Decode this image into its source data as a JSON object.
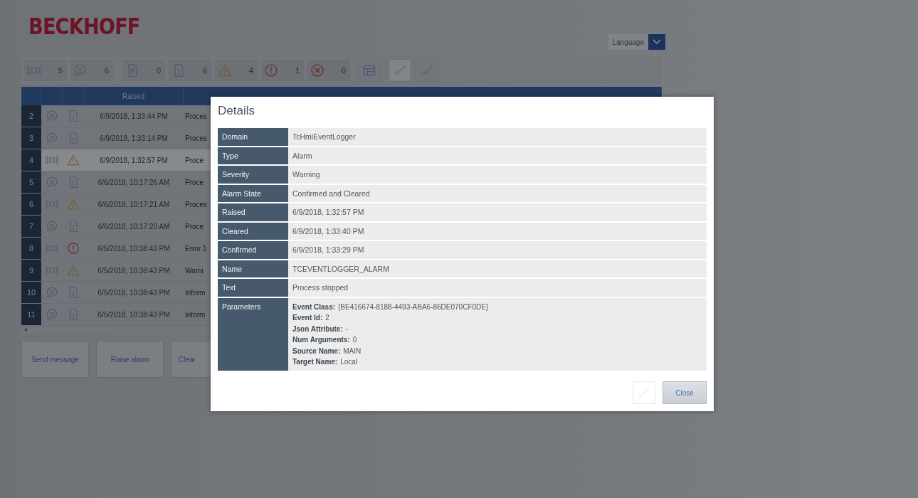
{
  "logo": "BECKHOFF",
  "language": {
    "label": "Language"
  },
  "filters": [
    {
      "kind": "alarm",
      "count": "5"
    },
    {
      "kind": "message",
      "count": "6"
    },
    {
      "kind": "document",
      "count": "0"
    },
    {
      "kind": "info",
      "count": "6"
    },
    {
      "kind": "warning",
      "count": "4"
    },
    {
      "kind": "error",
      "count": "1"
    },
    {
      "kind": "critical",
      "count": "0"
    }
  ],
  "table": {
    "columns": [
      "",
      "",
      "",
      "Raised"
    ],
    "rows": [
      {
        "number": "2",
        "icons": [
          {
            "kind": "message"
          },
          {
            "kind": "info"
          }
        ],
        "raised": "6/9/2018, 1:33:44 PM",
        "text": "Proces",
        "selected": false
      },
      {
        "number": "3",
        "icons": [
          {
            "kind": "message"
          },
          {
            "kind": "info"
          }
        ],
        "raised": "6/9/2018, 1:33:14 PM",
        "text": "Proces",
        "selected": false
      },
      {
        "number": "4",
        "icons": [
          {
            "kind": "alarm"
          },
          {
            "kind": "warning"
          }
        ],
        "raised": "6/9/2018, 1:32:57 PM",
        "text": "Proce",
        "selected": true
      },
      {
        "number": "5",
        "icons": [
          {
            "kind": "message"
          },
          {
            "kind": "info"
          }
        ],
        "raised": "6/6/2018, 10:17:26 AM",
        "text": "Proce",
        "selected": false
      },
      {
        "number": "6",
        "icons": [
          {
            "kind": "alarm"
          },
          {
            "kind": "warning"
          }
        ],
        "raised": "6/6/2018, 10:17:21 AM",
        "text": "Proces",
        "selected": false
      },
      {
        "number": "7",
        "icons": [
          {
            "kind": "message"
          },
          {
            "kind": "info"
          }
        ],
        "raised": "6/6/2018, 10:17:20 AM",
        "text": "Proce",
        "selected": false
      },
      {
        "number": "8",
        "icons": [
          {
            "kind": "alarm"
          },
          {
            "kind": "error"
          }
        ],
        "raised": "6/5/2018, 10:38:43 PM",
        "text": "Error 1",
        "selected": false
      },
      {
        "number": "9",
        "icons": [
          {
            "kind": "alarm"
          },
          {
            "kind": "warning"
          }
        ],
        "raised": "6/5/2018, 10:38:43 PM",
        "text": "Warni",
        "selected": false
      },
      {
        "number": "10",
        "icons": [
          {
            "kind": "message"
          },
          {
            "kind": "info"
          }
        ],
        "raised": "6/5/2018, 10:38:43 PM",
        "text": "Inform",
        "selected": false
      },
      {
        "number": "11",
        "icons": [
          {
            "kind": "message"
          },
          {
            "kind": "info"
          }
        ],
        "raised": "6/5/2018, 10:38:43 PM",
        "text": "Inform",
        "selected": false
      }
    ]
  },
  "buttons": [
    "Send message",
    "Raise alarm",
    "Clear"
  ],
  "dialog": {
    "title": "Details",
    "fields": [
      {
        "label": "Domain",
        "value": "TcHmiEventLogger"
      },
      {
        "label": "Type",
        "value": "Alarm"
      },
      {
        "label": "Severity",
        "value": "Warning"
      },
      {
        "label": "Alarm State",
        "value": "Confirmed and Cleared"
      },
      {
        "label": "Raised",
        "value": "6/9/2018, 1:32:57 PM"
      },
      {
        "label": "Cleared",
        "value": "6/9/2018, 1:33:40 PM"
      },
      {
        "label": "Confirmed",
        "value": "6/9/2018, 1:33:29 PM"
      },
      {
        "label": "Name",
        "value": "TCEVENTLOGGER_ALARM"
      },
      {
        "label": "Text",
        "value": "Process stopped"
      }
    ],
    "parameters": {
      "label": "Parameters",
      "items": [
        {
          "key": "Event Class:",
          "value": "{BE416674-8188-4493-ABA6-86DE070CF0DE}"
        },
        {
          "key": "Event Id:",
          "value": "2"
        },
        {
          "key": "Json Attribute:",
          "value": "-"
        },
        {
          "key": "Num Arguments:",
          "value": "0"
        },
        {
          "key": "Source Name:",
          "value": "MAIN"
        },
        {
          "key": "Target Name:",
          "value": "Local"
        }
      ]
    },
    "confirm": {
      "disabled": true
    },
    "close": "Close"
  }
}
